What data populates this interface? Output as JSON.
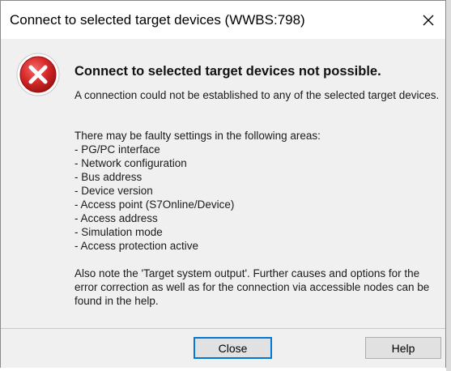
{
  "window": {
    "title": "Connect to selected target devices (WWBS:798)"
  },
  "message": {
    "icon": "error-icon",
    "heading": "Connect to selected target devices not possible.",
    "intro": "A connection could not be established to any of the selected target devices.",
    "areas_intro": "There may be faulty settings in the following areas:",
    "areas": [
      "- PG/PC interface",
      "- Network configuration",
      "- Bus address",
      "- Device version",
      "- Access point (S7Online/Device)",
      "- Access address",
      "- Simulation mode",
      "- Access protection active"
    ],
    "note": "Also note the 'Target system output'. Further causes and options for the error correction as well as for the connection via accessible nodes can be found in the help."
  },
  "buttons": {
    "close_label": "Close",
    "help_label": "Help"
  },
  "colors": {
    "error_red": "#d32f2f",
    "focus_border": "#0078d7",
    "dialog_bg": "#f0f0f0"
  }
}
